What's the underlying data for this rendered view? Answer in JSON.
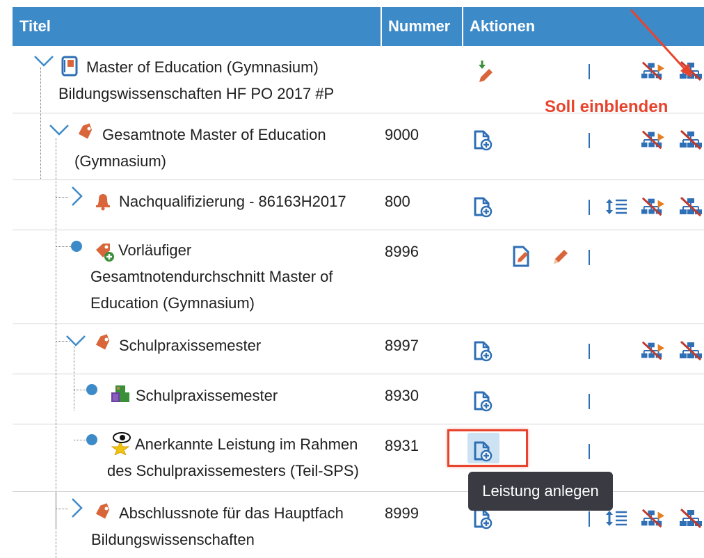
{
  "table": {
    "headers": {
      "title": "Titel",
      "number": "Nummer",
      "actions": "Aktionen"
    },
    "rows": [
      {
        "title_lines": [
          "Master of Education (Gymnasium)",
          "Bildungswissenschaften HF PO 2017 #P"
        ],
        "number": "",
        "icon": "book-icon"
      },
      {
        "title_lines": [
          "Gesamtnote Master of Education",
          "(Gymnasium)"
        ],
        "number": "9000",
        "icon": "tag-icon"
      },
      {
        "title_lines": [
          "Nachqualifizierung - 86163H2017"
        ],
        "number": "800",
        "icon": "bell-icon"
      },
      {
        "title_lines": [
          "Vorläufiger",
          "Gesamtnotendurchschnitt Master of",
          "Education (Gymnasium)"
        ],
        "number": "8996",
        "icon": "tag-plus-icon"
      },
      {
        "title_lines": [
          "Schulpraxissemester"
        ],
        "number": "8997",
        "icon": "tag-icon"
      },
      {
        "title_lines": [
          "Schulpraxissemester"
        ],
        "number": "8930",
        "icon": "blocks-icon"
      },
      {
        "title_lines": [
          "Anerkannte Leistung im Rahmen",
          "des Schulpraxissemesters (Teil-SPS)"
        ],
        "number": "8931",
        "icon": "star-eye-icon"
      },
      {
        "title_lines": [
          "Abschlussnote für das Hauptfach",
          "Bildungswissenschaften"
        ],
        "number": "8999",
        "icon": "tag-icon"
      }
    ]
  },
  "annotation": {
    "text": "Soll einblenden"
  },
  "tooltip": {
    "text": "Leistung anlegen"
  },
  "colors": {
    "header": "#3d8ac9",
    "accent_red": "#e8442d",
    "icon_blue": "#2e6fb5",
    "icon_orange": "#d9663a"
  }
}
